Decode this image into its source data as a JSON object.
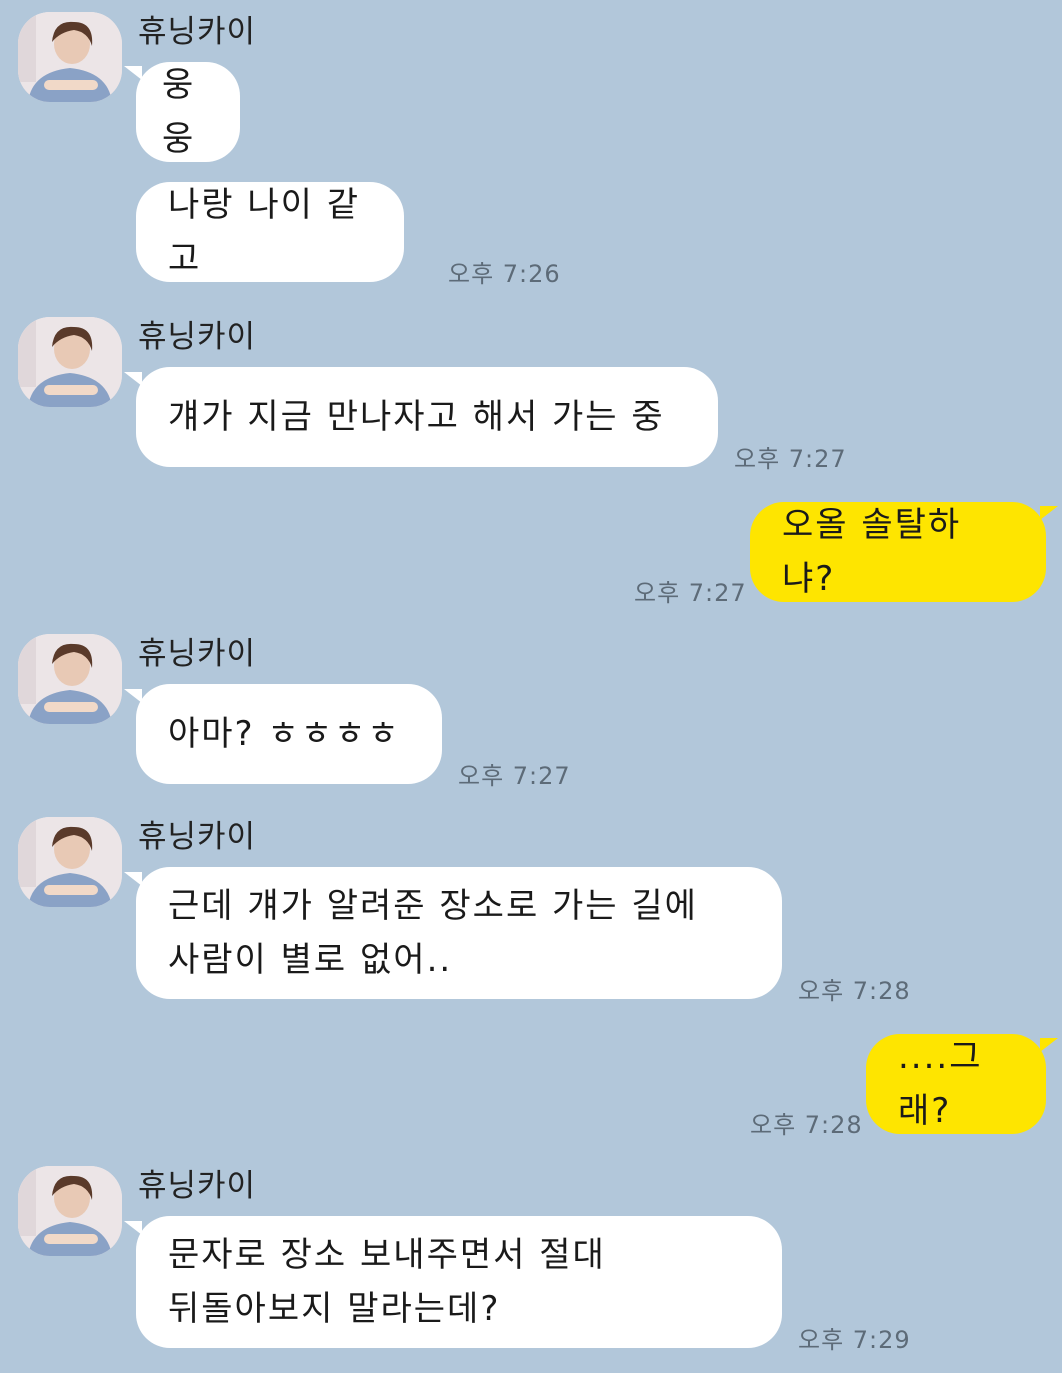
{
  "sender_name": "휴닝카이",
  "avatar_icon": "profile-photo",
  "colors": {
    "background": "#b2c7da",
    "incoming_bubble": "#ffffff",
    "outgoing_bubble": "#fee500"
  },
  "messages": [
    {
      "direction": "in",
      "text": "웅웅",
      "time": ""
    },
    {
      "direction": "in",
      "text": "나랑 나이 같고",
      "time": "오후 7:26"
    },
    {
      "direction": "in",
      "text": "걔가 지금 만나자고 해서 가는 중",
      "time": "오후 7:27"
    },
    {
      "direction": "out",
      "text": "오올 솔탈하냐?",
      "time": "오후 7:27"
    },
    {
      "direction": "in",
      "text": "아마? ㅎㅎㅎㅎ",
      "time": "오후 7:27"
    },
    {
      "direction": "in",
      "lines": [
        "근데 걔가 알려준 장소로 가는 길에",
        "사람이 별로 없어.."
      ],
      "time": "오후 7:28"
    },
    {
      "direction": "out",
      "text": "....그래?",
      "time": "오후 7:28"
    },
    {
      "direction": "in",
      "lines": [
        "문자로 장소 보내주면서 절대",
        "뒤돌아보지 말라는데?"
      ],
      "time": "오후 7:29"
    }
  ]
}
